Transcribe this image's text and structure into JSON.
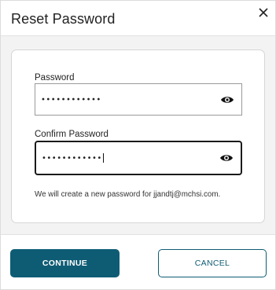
{
  "dialog": {
    "title": "Reset Password",
    "close_icon": "close-icon"
  },
  "form": {
    "password": {
      "label": "Password",
      "masked_value": "••••••••••••",
      "toggle_icon": "eye-icon"
    },
    "confirm_password": {
      "label": "Confirm Password",
      "masked_value": "••••••••••••",
      "toggle_icon": "eye-icon"
    },
    "note": "We will create a new password for jjandtj@mchsi.com."
  },
  "actions": {
    "continue_label": "CONTINUE",
    "cancel_label": "CANCEL"
  },
  "colors": {
    "primary": "#0e5c74",
    "background_panel": "#f3f3f3"
  }
}
